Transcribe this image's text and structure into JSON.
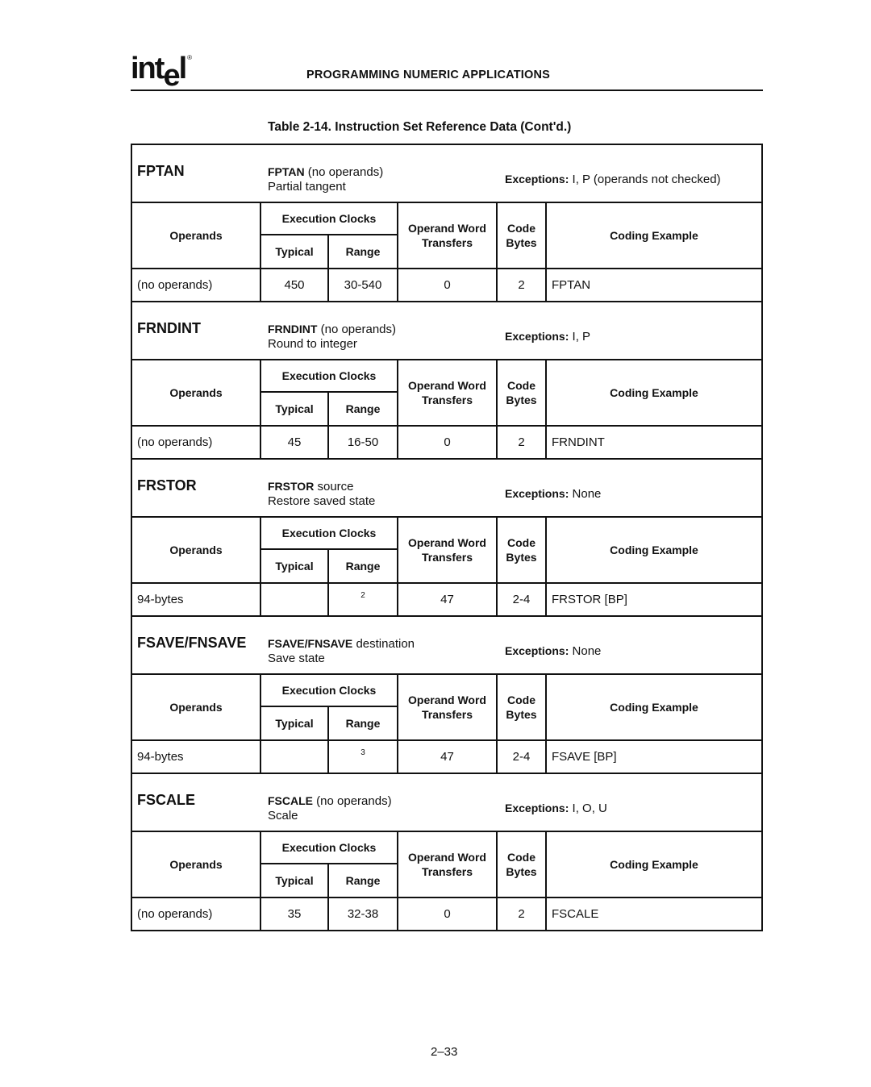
{
  "header": {
    "logo_text": "int",
    "logo_e": "e",
    "logo_l": "l",
    "logo_reg": "®",
    "running_head": "PROGRAMMING NUMERIC APPLICATIONS"
  },
  "table": {
    "caption": "Table 2-14.  Instruction Set Reference Data (Cont'd.)",
    "column_headers": {
      "operands": "Operands",
      "execution_clocks": "Execution Clocks",
      "typical": "Typical",
      "range": "Range",
      "operand_word_transfers_line1": "Operand Word",
      "operand_word_transfers_line2": "Transfers",
      "code_bytes_line1": "Code",
      "code_bytes_line2": "Bytes",
      "coding_example": "Coding Example"
    },
    "exceptions_label": "Exceptions:",
    "instructions": [
      {
        "name": "FPTAN",
        "syntax_mnemonic": "FPTAN",
        "syntax_operand": " (no operands)",
        "description": "Partial tangent",
        "exceptions": " I, P (operands not checked)",
        "row": {
          "operands": "(no operands)",
          "typical": "450",
          "range": "30-540",
          "range_note": "",
          "operand_word_transfers": "0",
          "code_bytes": "2",
          "coding_example": "FPTAN"
        }
      },
      {
        "name": "FRNDINT",
        "syntax_mnemonic": "FRNDINT",
        "syntax_operand": " (no operands)",
        "description": "Round to integer",
        "exceptions": " I, P",
        "row": {
          "operands": "(no operands)",
          "typical": "45",
          "range": "16-50",
          "range_note": "",
          "operand_word_transfers": "0",
          "code_bytes": "2",
          "coding_example": "FRNDINT"
        }
      },
      {
        "name": "FRSTOR",
        "syntax_mnemonic": "FRSTOR",
        "syntax_operand": " source",
        "description": "Restore saved state",
        "exceptions": " None",
        "row": {
          "operands": "94-bytes",
          "typical": "",
          "range": "",
          "range_note": "2",
          "operand_word_transfers": "47",
          "code_bytes": "2-4",
          "coding_example": "FRSTOR  [BP]"
        }
      },
      {
        "name": "FSAVE/FNSAVE",
        "syntax_mnemonic": "FSAVE/FNSAVE",
        "syntax_operand": " destination",
        "description": "Save state",
        "exceptions": " None",
        "row": {
          "operands": "94-bytes",
          "typical": "",
          "range": "",
          "range_note": "3",
          "operand_word_transfers": "47",
          "code_bytes": "2-4",
          "coding_example": "FSAVE  [BP]"
        }
      },
      {
        "name": "FSCALE",
        "syntax_mnemonic": "FSCALE",
        "syntax_operand": " (no operands)",
        "description": "Scale",
        "exceptions": " I, O, U",
        "row": {
          "operands": "(no operands)",
          "typical": "35",
          "range": "32-38",
          "range_note": "",
          "operand_word_transfers": "0",
          "code_bytes": "2",
          "coding_example": "FSCALE"
        }
      }
    ]
  },
  "footer": {
    "page_number": "2–33"
  }
}
